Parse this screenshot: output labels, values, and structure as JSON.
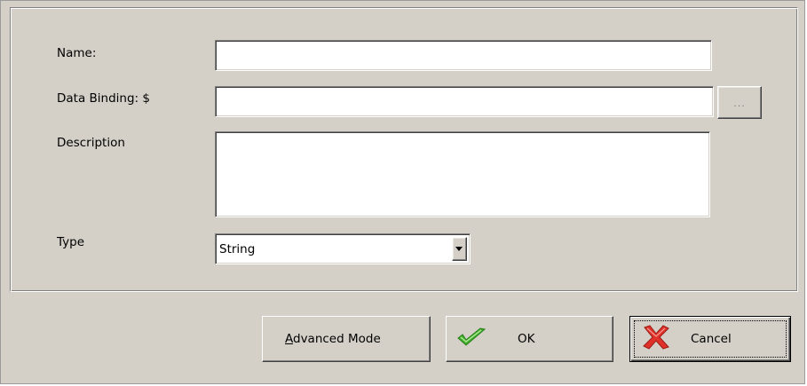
{
  "form": {
    "name_label": "Name:",
    "name_value": "",
    "binding_label": "Data Binding: $",
    "binding_value": "",
    "browse_label": "...",
    "description_label": "Description",
    "description_value": "",
    "type_label": "Type",
    "type_value": "String"
  },
  "buttons": {
    "advanced_mnemonic": "A",
    "advanced_rest": "dvanced Mode",
    "ok_label": "OK",
    "cancel_label": "Cancel"
  },
  "icons": {
    "ok": "green-checkmark-icon",
    "cancel": "red-x-icon",
    "dropdown": "chevron-down-icon"
  },
  "colors": {
    "dialog_bg": "#d4d0c8",
    "checkmark_green": "#3fae2a",
    "x_red": "#e0312b"
  }
}
